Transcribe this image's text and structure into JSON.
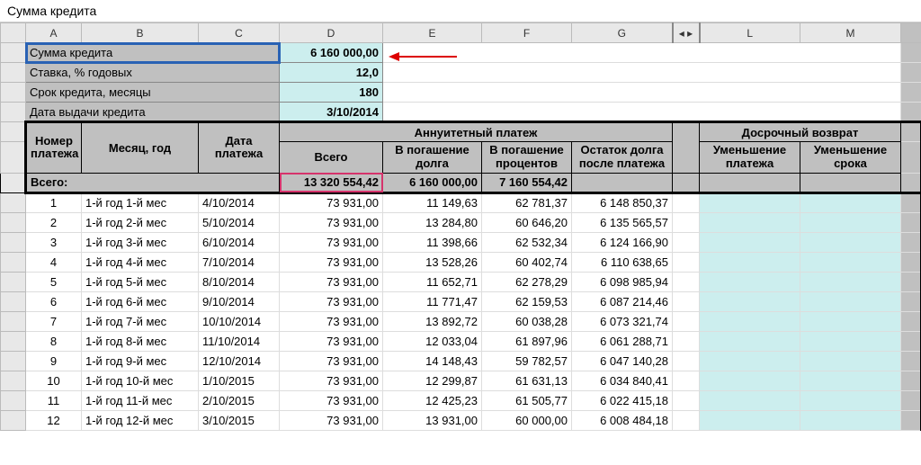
{
  "formula_bar": "Сумма кредита",
  "columns": [
    "A",
    "B",
    "C",
    "D",
    "E",
    "F",
    "G",
    "",
    "L",
    "M"
  ],
  "hidden_marker": "◂  ▸",
  "params": {
    "amount_label": "Сумма кредита",
    "amount_value": "6 160 000,00",
    "rate_label": "Ставка, % годовых",
    "rate_value": "12,0",
    "term_label": "Срок кредита, месяцы",
    "term_value": "180",
    "date_label": "Дата выдачи кредита",
    "date_value": "3/10/2014"
  },
  "headers": {
    "num": "Номер платежа",
    "month_year": "Месяц, год",
    "pay_date": "Дата платежа",
    "annuity_group": "Аннуитетный платеж",
    "total": "Всего",
    "principal": "В погашение долга",
    "interest": "В погашение процентов",
    "balance": "Остаток долга после платежа",
    "early_group": "Досрочный возврат",
    "early_reduce_pay": "Уменьшение платежа",
    "early_reduce_term": "Уменьшение срока"
  },
  "totals": {
    "label": "Всего:",
    "sum_total": "13 320 554,42",
    "sum_principal": "6 160 000,00",
    "sum_interest": "7 160 554,42"
  },
  "rows": [
    {
      "n": "1",
      "my": "1-й год 1-й мес",
      "d": "4/10/2014",
      "t": "73 931,00",
      "p": "11 149,63",
      "i": "62 781,37",
      "b": "6 148 850,37"
    },
    {
      "n": "2",
      "my": "1-й год 2-й мес",
      "d": "5/10/2014",
      "t": "73 931,00",
      "p": "13 284,80",
      "i": "60 646,20",
      "b": "6 135 565,57"
    },
    {
      "n": "3",
      "my": "1-й год 3-й мес",
      "d": "6/10/2014",
      "t": "73 931,00",
      "p": "11 398,66",
      "i": "62 532,34",
      "b": "6 124 166,90"
    },
    {
      "n": "4",
      "my": "1-й год 4-й мес",
      "d": "7/10/2014",
      "t": "73 931,00",
      "p": "13 528,26",
      "i": "60 402,74",
      "b": "6 110 638,65"
    },
    {
      "n": "5",
      "my": "1-й год 5-й мес",
      "d": "8/10/2014",
      "t": "73 931,00",
      "p": "11 652,71",
      "i": "62 278,29",
      "b": "6 098 985,94"
    },
    {
      "n": "6",
      "my": "1-й год 6-й мес",
      "d": "9/10/2014",
      "t": "73 931,00",
      "p": "11 771,47",
      "i": "62 159,53",
      "b": "6 087 214,46"
    },
    {
      "n": "7",
      "my": "1-й год 7-й мес",
      "d": "10/10/2014",
      "t": "73 931,00",
      "p": "13 892,72",
      "i": "60 038,28",
      "b": "6 073 321,74"
    },
    {
      "n": "8",
      "my": "1-й год 8-й мес",
      "d": "11/10/2014",
      "t": "73 931,00",
      "p": "12 033,04",
      "i": "61 897,96",
      "b": "6 061 288,71"
    },
    {
      "n": "9",
      "my": "1-й год 9-й мес",
      "d": "12/10/2014",
      "t": "73 931,00",
      "p": "14 148,43",
      "i": "59 782,57",
      "b": "6 047 140,28"
    },
    {
      "n": "10",
      "my": "1-й год 10-й мес",
      "d": "1/10/2015",
      "t": "73 931,00",
      "p": "12 299,87",
      "i": "61 631,13",
      "b": "6 034 840,41"
    },
    {
      "n": "11",
      "my": "1-й год 11-й мес",
      "d": "2/10/2015",
      "t": "73 931,00",
      "p": "12 425,23",
      "i": "61 505,77",
      "b": "6 022 415,18"
    },
    {
      "n": "12",
      "my": "1-й год 12-й мес",
      "d": "3/10/2015",
      "t": "73 931,00",
      "p": "13 931,00",
      "i": "60 000,00",
      "b": "6 008 484,18"
    }
  ]
}
